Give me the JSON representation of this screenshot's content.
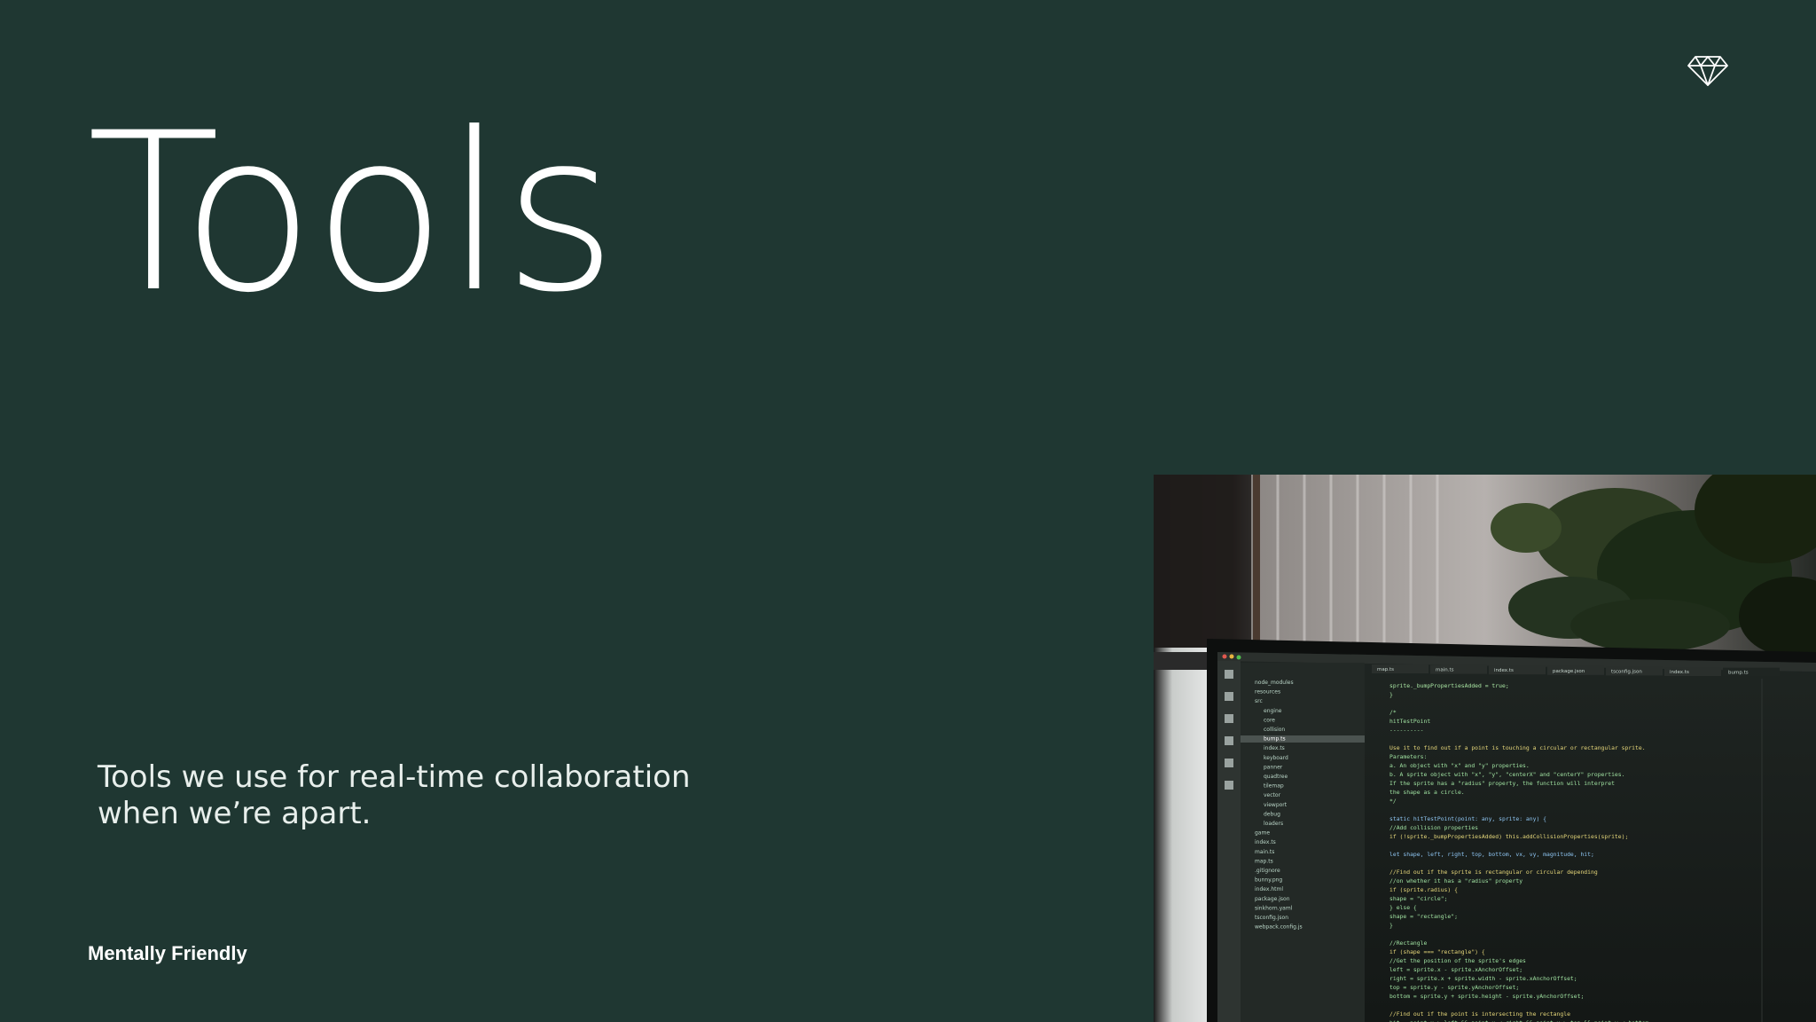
{
  "slide": {
    "title": "Tools",
    "subtitle_line1": "Tools we use for real-time collaboration",
    "subtitle_line2": "when we’re apart.",
    "brand": "Mentally Friendly"
  },
  "logo": {
    "icon": "diamond-icon"
  },
  "photo": {
    "description_icon": "code-editor-photo",
    "code_lines": [
      "sprite._bumpPropertiesAdded = true;",
      "}",
      "",
      "/*",
      " hitTestPoint",
      " ----------",
      "",
      " Use it to find out if a point is touching a circular or rectangular sprite.",
      " Parameters:",
      " a. An object with \"x\" and \"y\" properties.",
      " b. A sprite object with \"x\", \"y\", \"centerX\" and \"centerY\" properties.",
      " If the sprite has a \"radius\" property, the function will interpret",
      " the shape as a circle.",
      "*/",
      "",
      "static hitTestPoint(point: any, sprite: any) {",
      "  //Add collision properties",
      "  if (!sprite._bumpPropertiesAdded) this.addCollisionProperties(sprite);",
      "",
      "  let shape, left, right, top, bottom, vx, vy, magnitude, hit;",
      "",
      "  //Find out if the sprite is rectangular or circular depending",
      "  //on whether it has a \"radius\" property",
      "  if (sprite.radius) {",
      "    shape = \"circle\";",
      "  } else {",
      "    shape = \"rectangle\";",
      "  }",
      "",
      "  //Rectangle",
      "  if (shape === \"rectangle\") {",
      "    //Get the position of the sprite's edges",
      "    left = sprite.x - sprite.xAnchorOffset;",
      "    right = sprite.x + sprite.width - sprite.xAnchorOffset;",
      "    top = sprite.y - sprite.yAnchorOffset;",
      "    bottom = sprite.y + sprite.height - sprite.yAnchorOffset;",
      "",
      "    //Find out if the point is intersecting the rectangle",
      "    hit = point.x > left && point.x < right && point.y > top && point.y < bottom;"
    ],
    "tree_items": [
      "node_modules",
      "resources",
      "src",
      "engine",
      "core",
      "collision",
      "bump.ts",
      "index.ts",
      "keyboard",
      "panner",
      "quadtree",
      "tilemap",
      "vector",
      "viewport",
      "debug",
      "loaders",
      "game",
      "index.ts",
      "main.ts",
      "map.ts",
      ".gitignore",
      "bunny.png",
      "index.html",
      "package.json",
      "sinkhorn.yaml",
      "tsconfig.json",
      "webpack.config.js"
    ],
    "tabs": [
      "map.ts",
      "main.ts",
      "index.ts",
      "package.json",
      "tsconfig.json",
      "index.ts",
      "bump.ts"
    ]
  }
}
